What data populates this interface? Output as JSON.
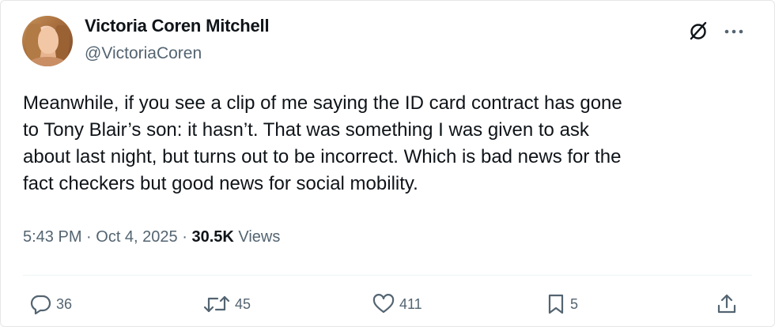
{
  "author": {
    "display_name": "Victoria Coren Mitchell",
    "handle": "@VictoriaCoren"
  },
  "header_icons": {
    "grok": "grok-icon",
    "more": "more-icon"
  },
  "tweet": {
    "text": "Meanwhile, if you see a clip of me saying the ID card contract has gone\nto Tony Blair’s son: it hasn’t. That was something I was given to ask\nabout last night, but turns out to be incorrect. Which is bad news for the\nfact checkers but good news for social mobility."
  },
  "meta": {
    "time": "5:43 PM",
    "sep1": " · ",
    "date": "Oct 4, 2025",
    "sep2": " · ",
    "views_count": "30.5K",
    "views_label": " Views"
  },
  "actions": {
    "replies": {
      "icon": "reply-icon",
      "count": "36"
    },
    "reposts": {
      "icon": "repost-icon",
      "count": "45"
    },
    "likes": {
      "icon": "like-icon",
      "count": "411"
    },
    "bookmarks": {
      "icon": "bookmark-icon",
      "count": "5"
    },
    "share": {
      "icon": "share-icon"
    }
  },
  "colors": {
    "text": "#0f1419",
    "secondary": "#536471",
    "divider": "#eff3f4"
  }
}
